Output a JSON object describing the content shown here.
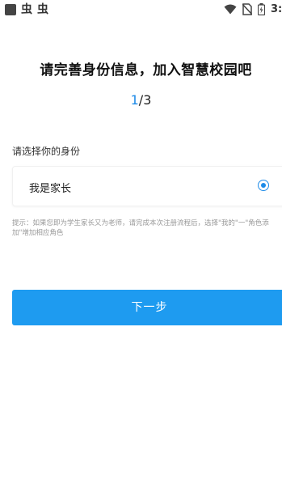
{
  "status_bar": {
    "app_glyph_1": "虫",
    "app_glyph_2": "虫",
    "time": "3:",
    "icons": [
      "wifi-icon",
      "no-sim-icon",
      "battery-icon"
    ]
  },
  "page": {
    "title": "请完善身份信息，加入智慧校园吧",
    "step_current": "1",
    "step_total": "/3"
  },
  "identity_section": {
    "label": "请选择你的身份",
    "options": [
      {
        "label": "我是家长",
        "selected": true
      }
    ]
  },
  "hint": "提示：如果您即为学生家长又为老师，请完成本次注册流程后，选择\"我的\"一\"角色添加\"增加相应角色",
  "actions": {
    "next_label": "下一步"
  },
  "colors": {
    "accent": "#1e8be8",
    "button": "#1e9bf0",
    "hint": "#9a9a9a"
  }
}
